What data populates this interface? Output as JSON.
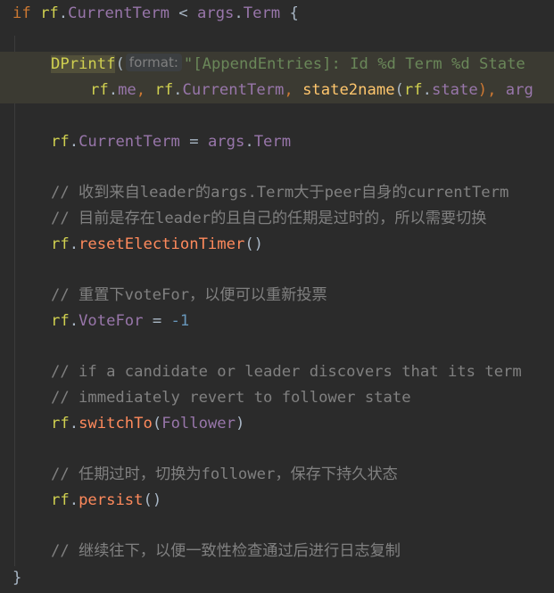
{
  "code": {
    "line1": {
      "if": "if",
      "rf": "rf",
      "dot": ".",
      "currentTerm": "CurrentTerm",
      "lt": " < ",
      "args": "args",
      "term": "Term",
      "brace": " {"
    },
    "line2": {
      "fn": "DPrintf",
      "open": "(",
      "hint": "format:",
      "str": "\"[AppendEntries]: Id %d Term %d State"
    },
    "line3": {
      "rf1": "rf",
      "me": "me",
      "comma1": ", ",
      "rf2": "rf",
      "ct": "CurrentTerm",
      "comma2": ", ",
      "s2n": "state2name",
      "open": "(",
      "rf3": "rf",
      "state": "state",
      "close": "), ",
      "args": "arg"
    },
    "line4": {
      "rf": "rf",
      "ct": "CurrentTerm",
      "eq": " = ",
      "args": "args",
      "term": "Term"
    },
    "comment1": "// 收到来自leader的args.Term大于peer自身的currentTerm",
    "comment2": "// 目前是存在leader的且自己的任期是过时的，所以需要切换",
    "line5": {
      "rf": "rf",
      "call": "resetElectionTimer",
      "parens": "()"
    },
    "comment3": "// 重置下voteFor，以便可以重新投票",
    "line6": {
      "rf": "rf",
      "field": "VoteFor",
      "eq": " = ",
      "num": "-1"
    },
    "comment4": "// if a candidate or leader discovers that its term",
    "comment5": "// immediately revert to follower state",
    "line7": {
      "rf": "rf",
      "call": "switchTo",
      "open": "(",
      "arg": "Follower",
      "close": ")"
    },
    "comment6": "// 任期过时，切换为follower，保存下持久状态",
    "line8": {
      "rf": "rf",
      "call": "persist",
      "parens": "()"
    },
    "comment7": "// 继续往下，以便一致性检查通过后进行日志复制",
    "closing": "}"
  }
}
